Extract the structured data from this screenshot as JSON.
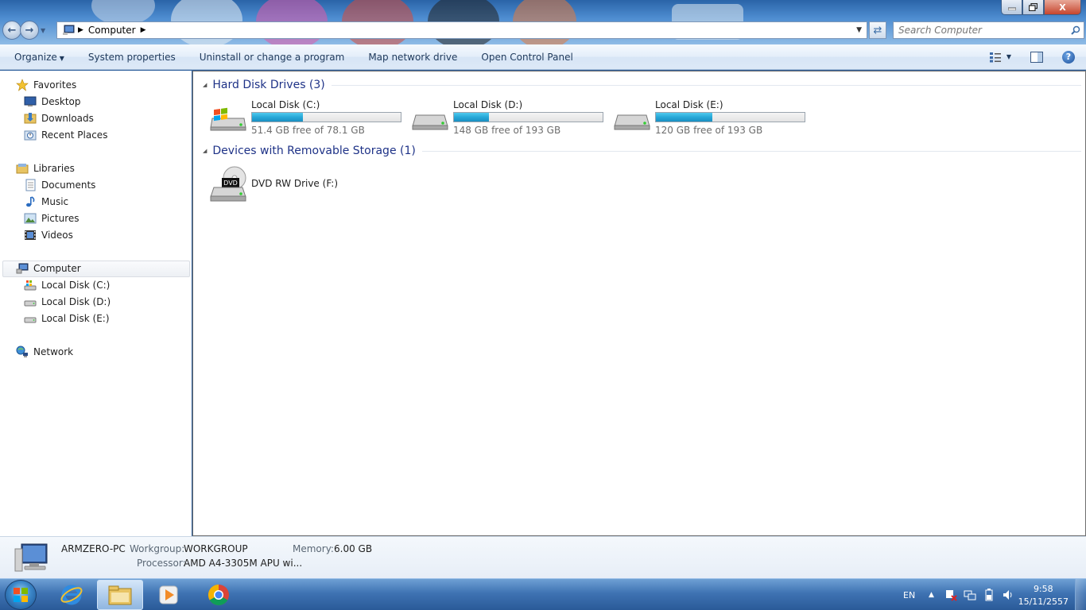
{
  "window": {
    "minimize_icon": "minimize-icon",
    "maximize_icon": "restore-icon",
    "close_label": "X"
  },
  "address": {
    "crumbs": [
      "Computer"
    ],
    "search_placeholder": "Search Computer"
  },
  "toolbar": {
    "organize": "Organize",
    "system_properties": "System properties",
    "uninstall": "Uninstall or change a program",
    "map_drive": "Map network drive",
    "control_panel": "Open Control Panel"
  },
  "nav": {
    "favorites": "Favorites",
    "desktop": "Desktop",
    "downloads": "Downloads",
    "recent": "Recent Places",
    "libraries": "Libraries",
    "documents": "Documents",
    "music": "Music",
    "pictures": "Pictures",
    "videos": "Videos",
    "computer": "Computer",
    "disk_c": "Local Disk (C:)",
    "disk_d": "Local Disk (D:)",
    "disk_e": "Local Disk (E:)",
    "network": "Network"
  },
  "groups": {
    "hdd_title": "Hard Disk Drives (3)",
    "removable_title": "Devices with Removable Storage (1)"
  },
  "drives": [
    {
      "name": "Local Disk (C:)",
      "free_text": "51.4 GB free of 78.1 GB",
      "used_fraction": 0.342
    },
    {
      "name": "Local Disk (D:)",
      "free_text": "148 GB free of 193 GB",
      "used_fraction": 0.233
    },
    {
      "name": "Local Disk (E:)",
      "free_text": "120 GB free of 193 GB",
      "used_fraction": 0.378
    }
  ],
  "removable": [
    {
      "name": "DVD RW Drive (F:)",
      "badge": "DVD"
    }
  ],
  "details": {
    "pc_name": "ARMZERO-PC",
    "workgroup_label": "Workgroup:",
    "workgroup_value": "WORKGROUP",
    "memory_label": "Memory:",
    "memory_value": "6.00 GB",
    "processor_label": "Processor:",
    "processor_value": "AMD A4-3305M APU wi..."
  },
  "taskbar": {
    "language": "EN",
    "time": "9:58",
    "date": "15/11/2557"
  },
  "colors": {
    "accent": "#1e3287",
    "bar_fill": "#27a8d8",
    "taskbar": "#3f73b3"
  }
}
